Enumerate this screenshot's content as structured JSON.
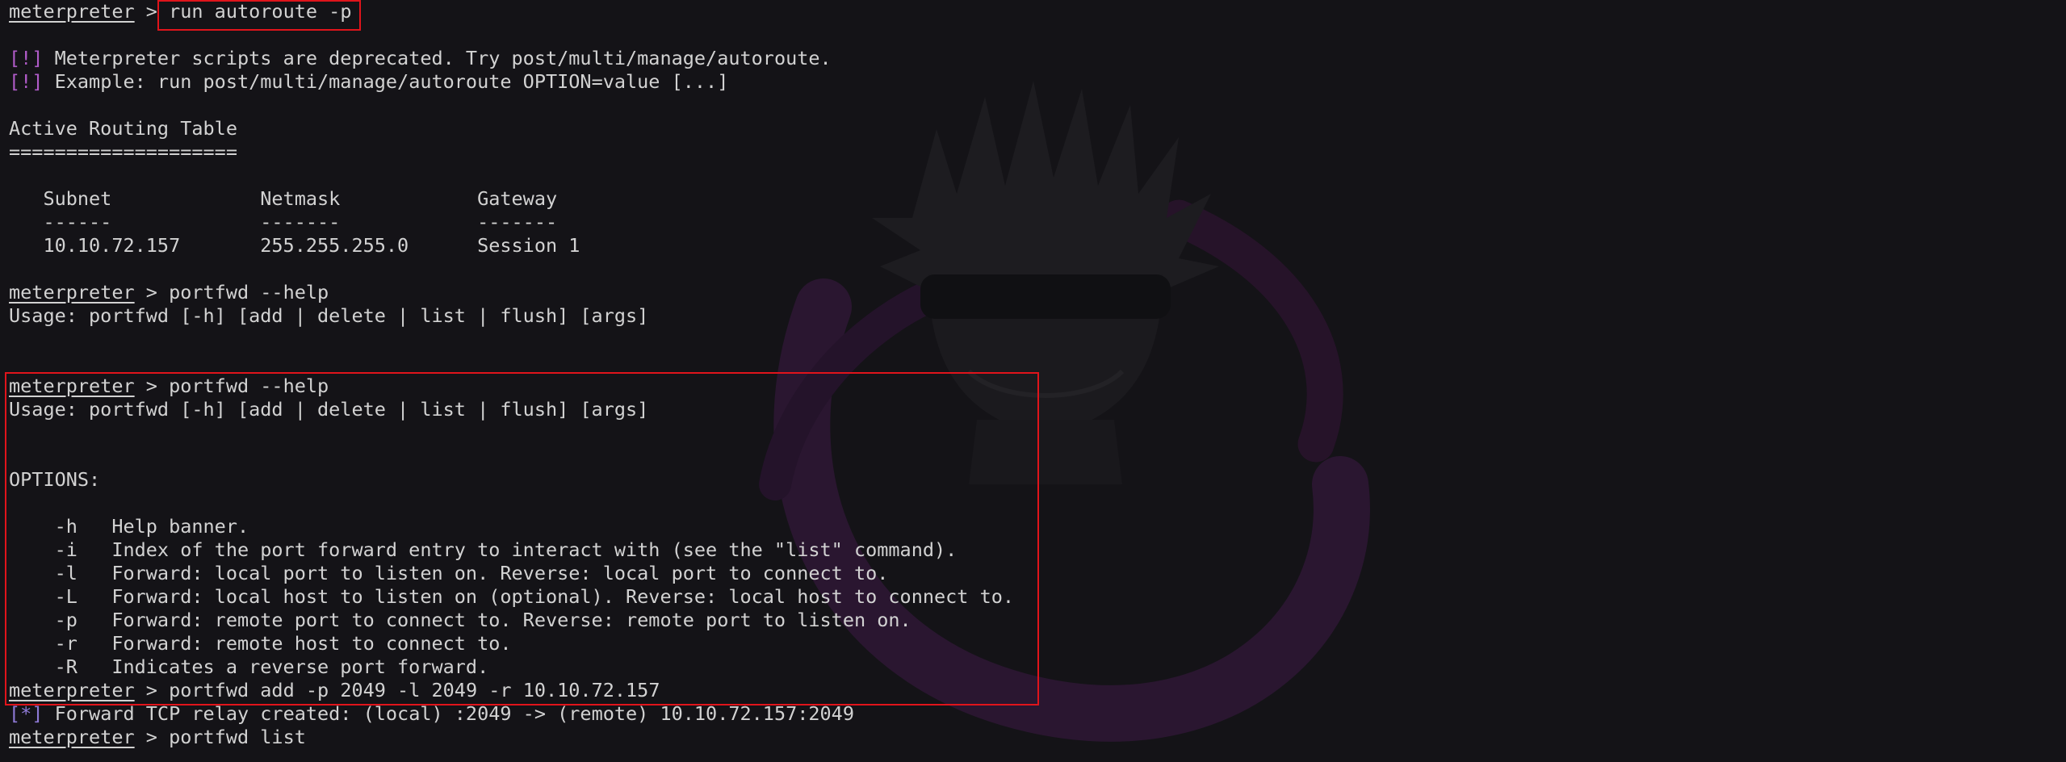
{
  "terminal": {
    "prompt": "meterpreter",
    "sep": " > ",
    "highlight_color": "#e0141b",
    "info_color": "#b05bc8",
    "status_color": "#8e79d6",
    "lines": {
      "l1_cmd": "run autoroute -p",
      "l2_tag": "[!]",
      "l2_text": " Meterpreter scripts are deprecated. Try post/multi/manage/autoroute.",
      "l3_tag": "[!]",
      "l3_text": " Example: run post/multi/manage/autoroute OPTION=value [...]",
      "l4": "Active Routing Table",
      "l5": "====================",
      "l6": "   Subnet             Netmask            Gateway",
      "l7": "   ------             -------            -------",
      "l8": "   10.10.72.157       255.255.255.0      Session 1",
      "l9_cmd": "portfwd --help",
      "l10": "Usage: portfwd [-h] [add | delete | list | flush] [args]",
      "l11_cmd": "portfwd --help",
      "l12": "Usage: portfwd [-h] [add | delete | list | flush] [args]",
      "l13": "OPTIONS:",
      "l14": "    -h   Help banner.",
      "l15": "    -i   Index of the port forward entry to interact with (see the \"list\" command).",
      "l16": "    -l   Forward: local port to listen on. Reverse: local port to connect to.",
      "l17": "    -L   Forward: local host to listen on (optional). Reverse: local host to connect to.",
      "l18": "    -p   Forward: remote port to connect to. Reverse: remote port to listen on.",
      "l19": "    -r   Forward: remote host to connect to.",
      "l20": "    -R   Indicates a reverse port forward.",
      "l21_cmd": "portfwd add -p 2049 -l 2049 -r 10.10.72.157",
      "l22_tag": "[*]",
      "l22_text": " Forward TCP relay created: (local) :2049 -> (remote) 10.10.72.157:2049",
      "l23_cmd": "portfwd list"
    }
  }
}
